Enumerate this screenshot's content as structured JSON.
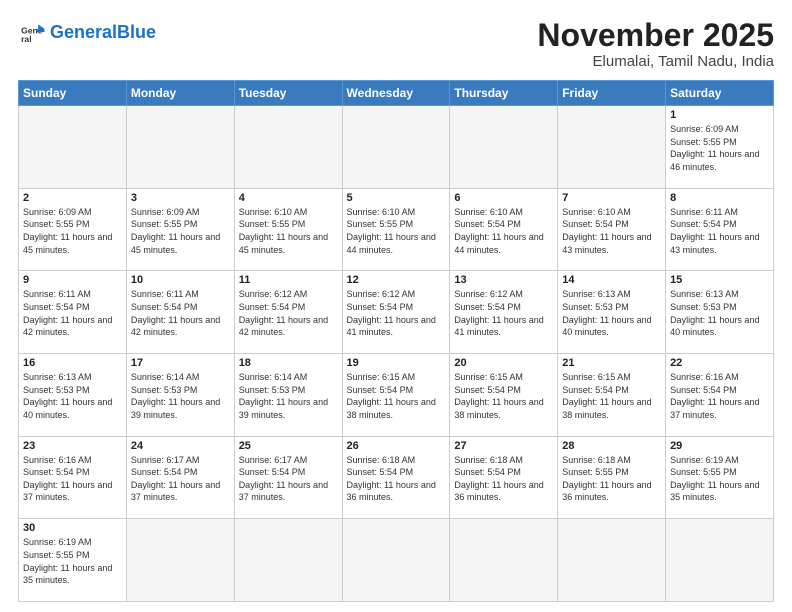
{
  "header": {
    "logo_general": "General",
    "logo_blue": "Blue",
    "month_title": "November 2025",
    "location": "Elumalai, Tamil Nadu, India"
  },
  "weekdays": [
    "Sunday",
    "Monday",
    "Tuesday",
    "Wednesday",
    "Thursday",
    "Friday",
    "Saturday"
  ],
  "weeks": [
    [
      {
        "day": "",
        "sunrise": "",
        "sunset": "",
        "daylight": "",
        "empty": true
      },
      {
        "day": "",
        "sunrise": "",
        "sunset": "",
        "daylight": "",
        "empty": true
      },
      {
        "day": "",
        "sunrise": "",
        "sunset": "",
        "daylight": "",
        "empty": true
      },
      {
        "day": "",
        "sunrise": "",
        "sunset": "",
        "daylight": "",
        "empty": true
      },
      {
        "day": "",
        "sunrise": "",
        "sunset": "",
        "daylight": "",
        "empty": true
      },
      {
        "day": "",
        "sunrise": "",
        "sunset": "",
        "daylight": "",
        "empty": true
      },
      {
        "day": "1",
        "sunrise": "Sunrise: 6:09 AM",
        "sunset": "Sunset: 5:55 PM",
        "daylight": "Daylight: 11 hours and 46 minutes.",
        "empty": false
      }
    ],
    [
      {
        "day": "2",
        "sunrise": "Sunrise: 6:09 AM",
        "sunset": "Sunset: 5:55 PM",
        "daylight": "Daylight: 11 hours and 45 minutes.",
        "empty": false
      },
      {
        "day": "3",
        "sunrise": "Sunrise: 6:09 AM",
        "sunset": "Sunset: 5:55 PM",
        "daylight": "Daylight: 11 hours and 45 minutes.",
        "empty": false
      },
      {
        "day": "4",
        "sunrise": "Sunrise: 6:10 AM",
        "sunset": "Sunset: 5:55 PM",
        "daylight": "Daylight: 11 hours and 45 minutes.",
        "empty": false
      },
      {
        "day": "5",
        "sunrise": "Sunrise: 6:10 AM",
        "sunset": "Sunset: 5:55 PM",
        "daylight": "Daylight: 11 hours and 44 minutes.",
        "empty": false
      },
      {
        "day": "6",
        "sunrise": "Sunrise: 6:10 AM",
        "sunset": "Sunset: 5:54 PM",
        "daylight": "Daylight: 11 hours and 44 minutes.",
        "empty": false
      },
      {
        "day": "7",
        "sunrise": "Sunrise: 6:10 AM",
        "sunset": "Sunset: 5:54 PM",
        "daylight": "Daylight: 11 hours and 43 minutes.",
        "empty": false
      },
      {
        "day": "8",
        "sunrise": "Sunrise: 6:11 AM",
        "sunset": "Sunset: 5:54 PM",
        "daylight": "Daylight: 11 hours and 43 minutes.",
        "empty": false
      }
    ],
    [
      {
        "day": "9",
        "sunrise": "Sunrise: 6:11 AM",
        "sunset": "Sunset: 5:54 PM",
        "daylight": "Daylight: 11 hours and 42 minutes.",
        "empty": false
      },
      {
        "day": "10",
        "sunrise": "Sunrise: 6:11 AM",
        "sunset": "Sunset: 5:54 PM",
        "daylight": "Daylight: 11 hours and 42 minutes.",
        "empty": false
      },
      {
        "day": "11",
        "sunrise": "Sunrise: 6:12 AM",
        "sunset": "Sunset: 5:54 PM",
        "daylight": "Daylight: 11 hours and 42 minutes.",
        "empty": false
      },
      {
        "day": "12",
        "sunrise": "Sunrise: 6:12 AM",
        "sunset": "Sunset: 5:54 PM",
        "daylight": "Daylight: 11 hours and 41 minutes.",
        "empty": false
      },
      {
        "day": "13",
        "sunrise": "Sunrise: 6:12 AM",
        "sunset": "Sunset: 5:54 PM",
        "daylight": "Daylight: 11 hours and 41 minutes.",
        "empty": false
      },
      {
        "day": "14",
        "sunrise": "Sunrise: 6:13 AM",
        "sunset": "Sunset: 5:53 PM",
        "daylight": "Daylight: 11 hours and 40 minutes.",
        "empty": false
      },
      {
        "day": "15",
        "sunrise": "Sunrise: 6:13 AM",
        "sunset": "Sunset: 5:53 PM",
        "daylight": "Daylight: 11 hours and 40 minutes.",
        "empty": false
      }
    ],
    [
      {
        "day": "16",
        "sunrise": "Sunrise: 6:13 AM",
        "sunset": "Sunset: 5:53 PM",
        "daylight": "Daylight: 11 hours and 40 minutes.",
        "empty": false
      },
      {
        "day": "17",
        "sunrise": "Sunrise: 6:14 AM",
        "sunset": "Sunset: 5:53 PM",
        "daylight": "Daylight: 11 hours and 39 minutes.",
        "empty": false
      },
      {
        "day": "18",
        "sunrise": "Sunrise: 6:14 AM",
        "sunset": "Sunset: 5:53 PM",
        "daylight": "Daylight: 11 hours and 39 minutes.",
        "empty": false
      },
      {
        "day": "19",
        "sunrise": "Sunrise: 6:15 AM",
        "sunset": "Sunset: 5:54 PM",
        "daylight": "Daylight: 11 hours and 38 minutes.",
        "empty": false
      },
      {
        "day": "20",
        "sunrise": "Sunrise: 6:15 AM",
        "sunset": "Sunset: 5:54 PM",
        "daylight": "Daylight: 11 hours and 38 minutes.",
        "empty": false
      },
      {
        "day": "21",
        "sunrise": "Sunrise: 6:15 AM",
        "sunset": "Sunset: 5:54 PM",
        "daylight": "Daylight: 11 hours and 38 minutes.",
        "empty": false
      },
      {
        "day": "22",
        "sunrise": "Sunrise: 6:16 AM",
        "sunset": "Sunset: 5:54 PM",
        "daylight": "Daylight: 11 hours and 37 minutes.",
        "empty": false
      }
    ],
    [
      {
        "day": "23",
        "sunrise": "Sunrise: 6:16 AM",
        "sunset": "Sunset: 5:54 PM",
        "daylight": "Daylight: 11 hours and 37 minutes.",
        "empty": false
      },
      {
        "day": "24",
        "sunrise": "Sunrise: 6:17 AM",
        "sunset": "Sunset: 5:54 PM",
        "daylight": "Daylight: 11 hours and 37 minutes.",
        "empty": false
      },
      {
        "day": "25",
        "sunrise": "Sunrise: 6:17 AM",
        "sunset": "Sunset: 5:54 PM",
        "daylight": "Daylight: 11 hours and 37 minutes.",
        "empty": false
      },
      {
        "day": "26",
        "sunrise": "Sunrise: 6:18 AM",
        "sunset": "Sunset: 5:54 PM",
        "daylight": "Daylight: 11 hours and 36 minutes.",
        "empty": false
      },
      {
        "day": "27",
        "sunrise": "Sunrise: 6:18 AM",
        "sunset": "Sunset: 5:54 PM",
        "daylight": "Daylight: 11 hours and 36 minutes.",
        "empty": false
      },
      {
        "day": "28",
        "sunrise": "Sunrise: 6:18 AM",
        "sunset": "Sunset: 5:55 PM",
        "daylight": "Daylight: 11 hours and 36 minutes.",
        "empty": false
      },
      {
        "day": "29",
        "sunrise": "Sunrise: 6:19 AM",
        "sunset": "Sunset: 5:55 PM",
        "daylight": "Daylight: 11 hours and 35 minutes.",
        "empty": false
      }
    ],
    [
      {
        "day": "30",
        "sunrise": "Sunrise: 6:19 AM",
        "sunset": "Sunset: 5:55 PM",
        "daylight": "Daylight: 11 hours and 35 minutes.",
        "empty": false
      },
      {
        "day": "",
        "sunrise": "",
        "sunset": "",
        "daylight": "",
        "empty": true
      },
      {
        "day": "",
        "sunrise": "",
        "sunset": "",
        "daylight": "",
        "empty": true
      },
      {
        "day": "",
        "sunrise": "",
        "sunset": "",
        "daylight": "",
        "empty": true
      },
      {
        "day": "",
        "sunrise": "",
        "sunset": "",
        "daylight": "",
        "empty": true
      },
      {
        "day": "",
        "sunrise": "",
        "sunset": "",
        "daylight": "",
        "empty": true
      },
      {
        "day": "",
        "sunrise": "",
        "sunset": "",
        "daylight": "",
        "empty": true
      }
    ]
  ]
}
